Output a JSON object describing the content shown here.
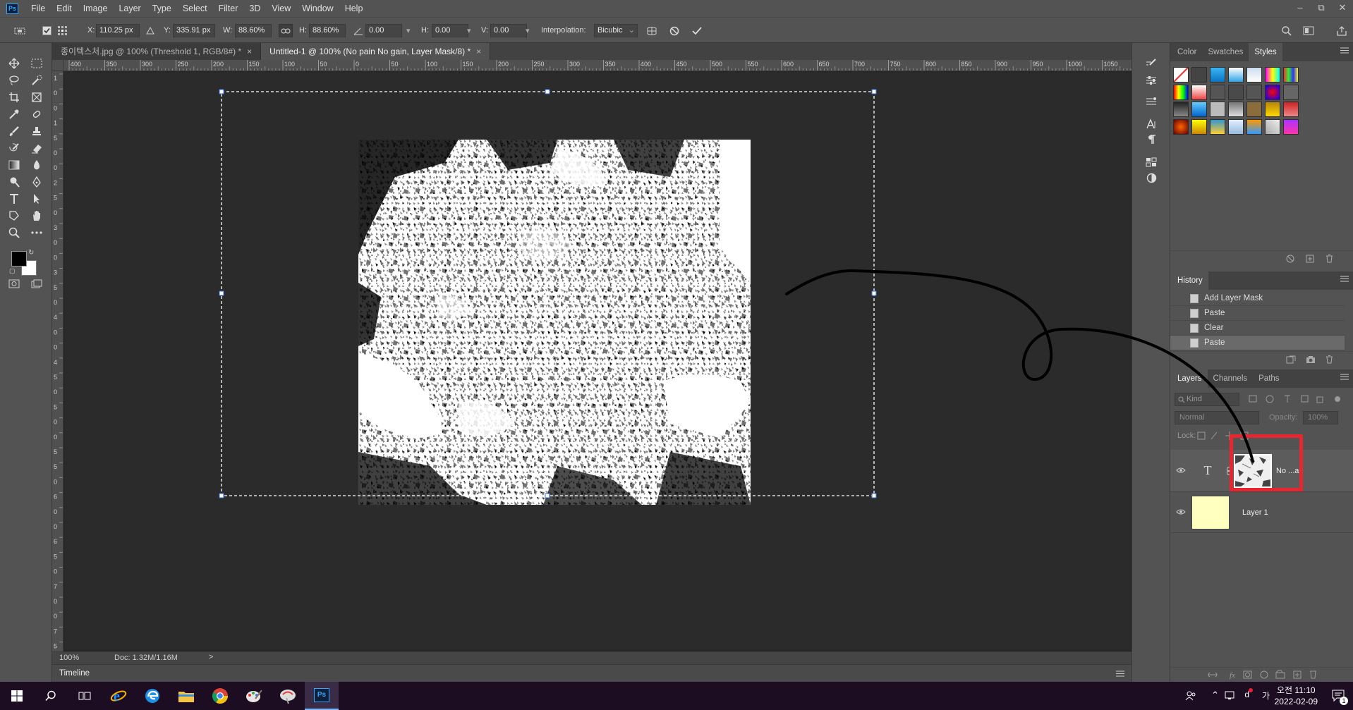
{
  "app": {
    "logo": "Ps"
  },
  "menu": [
    "File",
    "Edit",
    "Image",
    "Layer",
    "Type",
    "Select",
    "Filter",
    "3D",
    "View",
    "Window",
    "Help"
  ],
  "window_controls": [
    "minimize",
    "restore",
    "close"
  ],
  "options": {
    "x_label": "X:",
    "x_value": "110.25 px",
    "y_label": "Y:",
    "y_value": "335.91 px",
    "w_label": "W:",
    "w_value": "88.60%",
    "h_label": "H:",
    "h_value": "88.60%",
    "angle_value": "0.00",
    "hskew_label": "H:",
    "hskew_value": "0.00",
    "vskew_label": "V:",
    "vskew_value": "0.00",
    "interp_label": "Interpolation:",
    "interp_value": "Bicubic"
  },
  "tabs": [
    {
      "label": "종이텍스처.jpg @ 100% (Threshold 1, RGB/8#) *",
      "close": "×"
    },
    {
      "label": "Untitled-1 @ 100% (No pain No gain, Layer Mask/8) *",
      "close": "×"
    }
  ],
  "ruler_h": [
    "400",
    "350",
    "300",
    "250",
    "200",
    "150",
    "100",
    "50",
    "0",
    "50",
    "100",
    "150",
    "200",
    "250",
    "300",
    "350",
    "400",
    "450",
    "500",
    "550",
    "600",
    "650",
    "700",
    "750",
    "800",
    "850",
    "900",
    "950",
    "1000",
    "1050"
  ],
  "ruler_v": [
    "1",
    "0",
    "0",
    "1",
    "5",
    "0",
    "0",
    "2",
    "5",
    "0",
    "3",
    "0",
    "0",
    "3",
    "5",
    "0",
    "4",
    "0",
    "0",
    "4",
    "5",
    "0",
    "5",
    "0",
    "0",
    "5",
    "5",
    "0",
    "6",
    "0",
    "0",
    "6",
    "5",
    "0",
    "7",
    "0",
    "0",
    "7",
    "5"
  ],
  "status": {
    "zoom": "100%",
    "doc": "Doc: 1.32M/1.16M",
    "arrow": ">"
  },
  "timeline": {
    "label": "Timeline"
  },
  "panels": {
    "top_tabs": [
      "Color",
      "Swatches",
      "Styles"
    ],
    "history_title": "History",
    "history_items": [
      "Add Layer Mask",
      "Paste",
      "Clear",
      "Paste"
    ],
    "layers_tabs": [
      "Layers",
      "Channels",
      "Paths"
    ],
    "kind_placeholder": "Kind",
    "blend_mode": "Normal",
    "opacity_label": "Opacity:",
    "opacity_value": "100%",
    "lock_label": "Lock:",
    "layers": [
      {
        "name": "No ...ai",
        "type": "T"
      },
      {
        "name": "Layer 1"
      }
    ]
  },
  "taskbar": {
    "time": "오전 11:10",
    "date": "2022-02-09",
    "ime": "가",
    "notif": "1"
  },
  "colors": {
    "highlight": "#e8262f",
    "accent": "#31a8ff",
    "layer1_thumb": "#ffffc0"
  }
}
